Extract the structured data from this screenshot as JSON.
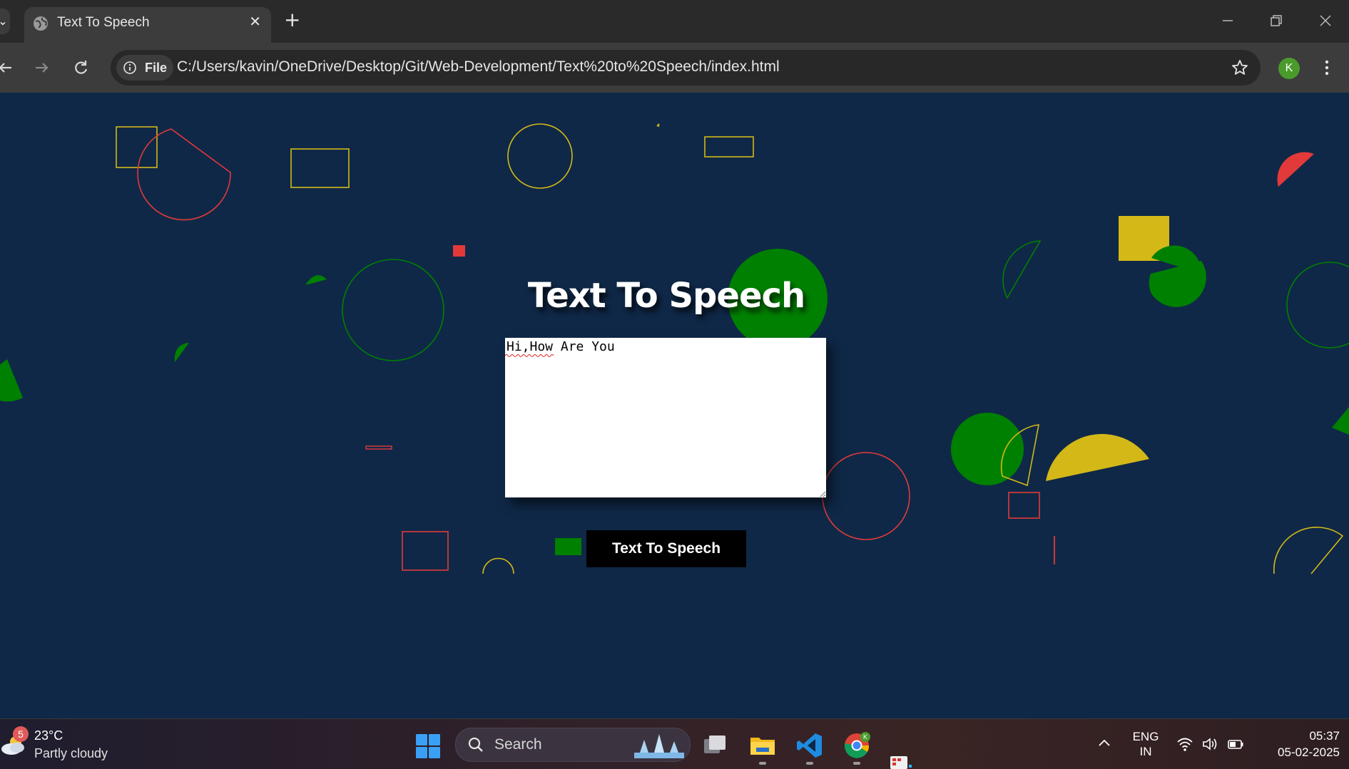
{
  "browser": {
    "tab_title": "Text To Speech",
    "tab_close_glyph": "✕",
    "new_tab_glyph": "+",
    "file_chip_label": "File",
    "url": "C:/Users/kavin/OneDrive/Desktop/Git/Web-Development/Text%20to%20Speech/index.html",
    "profile_initial": "K"
  },
  "page": {
    "title": "Text To Speech",
    "textarea_value": "Hi,How Are You",
    "button_label": "Text To Speech"
  },
  "taskbar": {
    "weather_badge": "5",
    "weather_temp": "23°C",
    "weather_desc": "Partly cloudy",
    "search_label": "Search",
    "lang_primary": "ENG",
    "lang_secondary": "IN",
    "time": "05:37",
    "date": "05-02-2025"
  },
  "colors": {
    "page_background": "#0f2847",
    "accent_red": "#e23a3a",
    "accent_yellow": "#d4b818",
    "accent_green": "#008000",
    "button_background": "#000000"
  }
}
